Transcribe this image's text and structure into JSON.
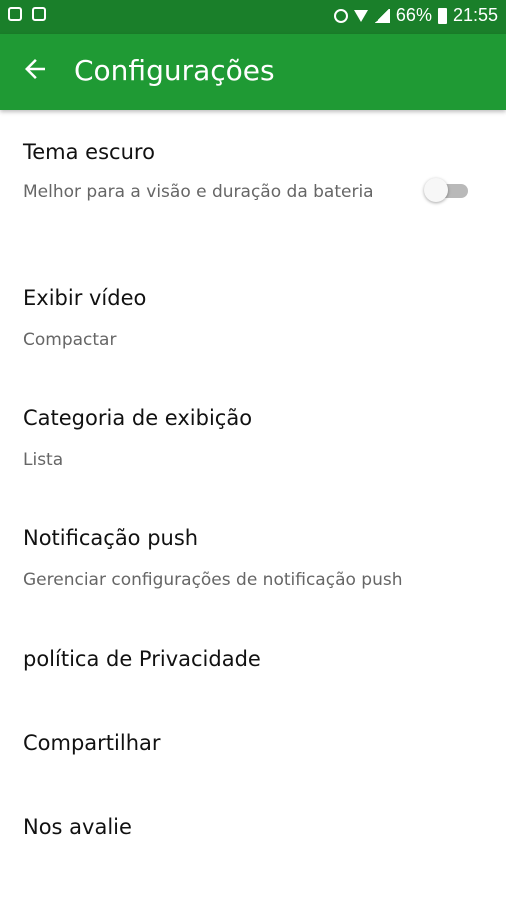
{
  "status_bar": {
    "battery_percent": "66%",
    "time": "21:55"
  },
  "app_bar": {
    "title": "Configurações"
  },
  "settings": {
    "items": [
      {
        "title": "Tema escuro",
        "subtitle": "Melhor para a visão e duração da bateria",
        "toggle_on": false
      },
      {
        "title": "Exibir vídeo",
        "subtitle": "Compactar"
      },
      {
        "title": "Categoria de exibição",
        "subtitle": "Lista"
      },
      {
        "title": "Notificação push",
        "subtitle": "Gerenciar configurações de notificação push"
      },
      {
        "title": "política de Privacidade"
      },
      {
        "title": "Compartilhar"
      },
      {
        "title": "Nos avalie"
      }
    ]
  },
  "colors": {
    "status_bar": "#1a7f2a",
    "app_bar": "#1f9a34",
    "toggle_track_off": "#b9b9b9"
  },
  "icons": {
    "back": "arrow-left-icon"
  }
}
